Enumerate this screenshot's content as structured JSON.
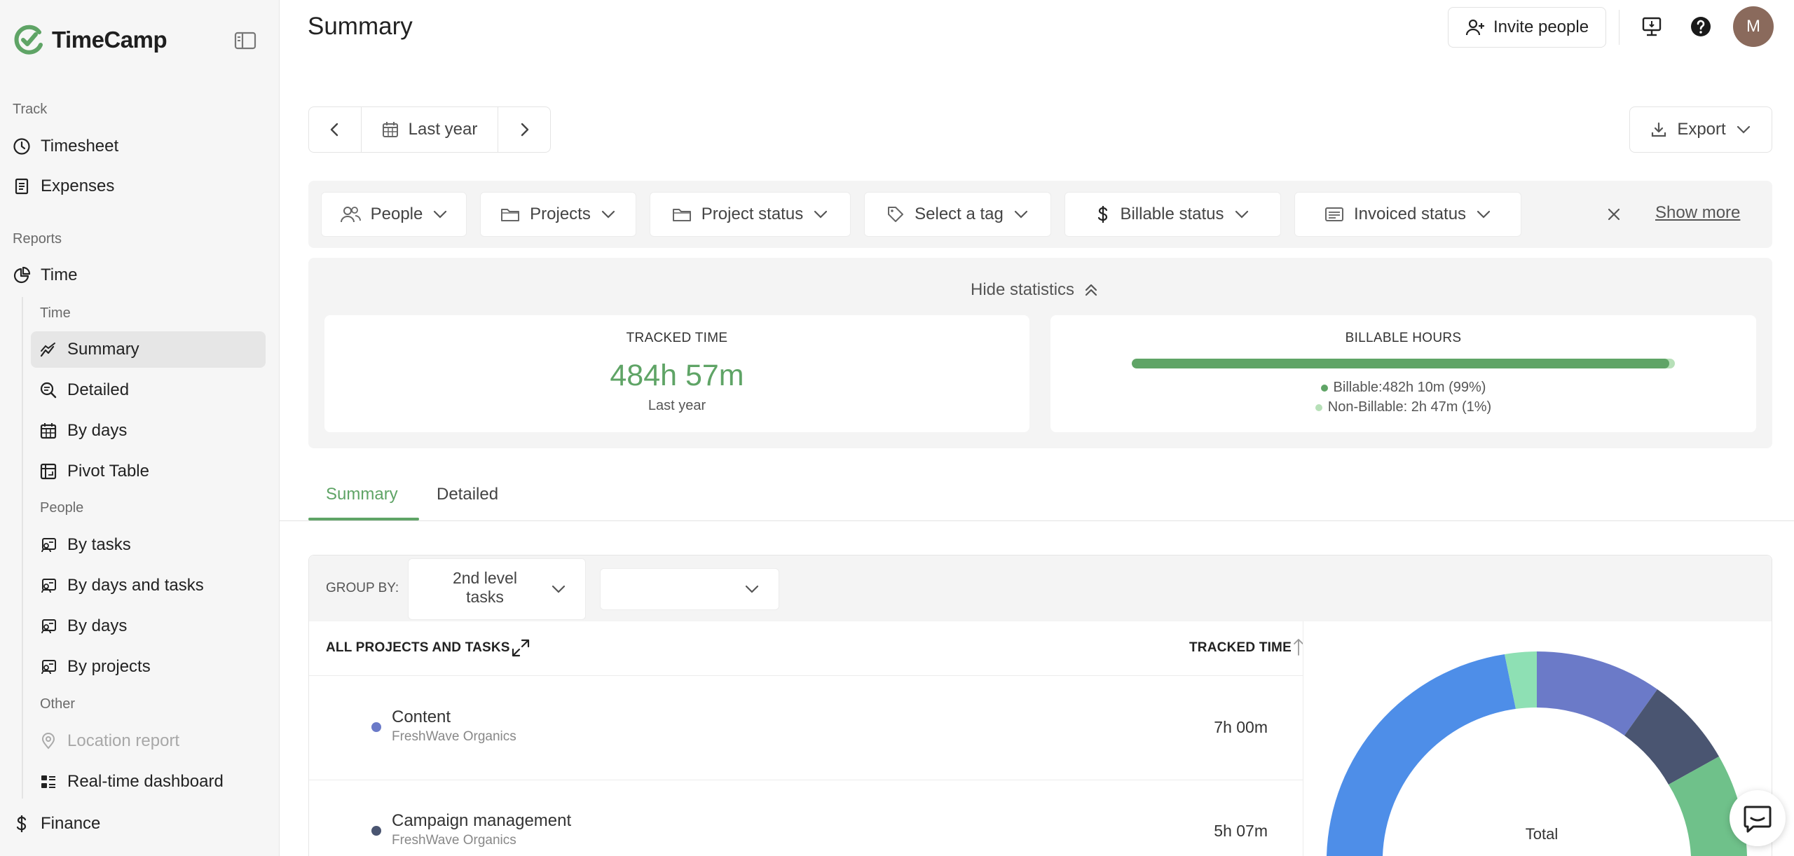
{
  "brand": {
    "name": "TimeCamp",
    "color": "#5fa466"
  },
  "sidebar": {
    "track_label": "Track",
    "track_items": [
      {
        "label": "Timesheet",
        "icon": "clock-icon"
      },
      {
        "label": "Expenses",
        "icon": "receipt-icon"
      }
    ],
    "reports_label": "Reports",
    "time_item": {
      "label": "Time",
      "icon": "pie-chart-icon"
    },
    "time_group_label": "Time",
    "time_items": [
      {
        "label": "Summary",
        "icon": "line-chart-icon",
        "active": true
      },
      {
        "label": "Detailed",
        "icon": "magnify-icon"
      },
      {
        "label": "By days",
        "icon": "calendar-grid-icon"
      },
      {
        "label": "Pivot Table",
        "icon": "pivot-table-icon"
      }
    ],
    "people_group_label": "People",
    "people_items": [
      {
        "label": "By tasks",
        "icon": "person-card-icon"
      },
      {
        "label": "By days and tasks",
        "icon": "person-card-icon"
      },
      {
        "label": "By days",
        "icon": "person-card-icon"
      },
      {
        "label": "By projects",
        "icon": "person-card-icon"
      }
    ],
    "other_group_label": "Other",
    "other_items": [
      {
        "label": "Location report",
        "icon": "location-pin-icon",
        "disabled": true
      },
      {
        "label": "Real-time dashboard",
        "icon": "dashboard-icon"
      }
    ],
    "finance_item": {
      "label": "Finance",
      "icon": "dollar-icon"
    }
  },
  "header": {
    "title": "Summary",
    "invite_label": "Invite people",
    "avatar_initial": "M"
  },
  "date_range": {
    "label": "Last year"
  },
  "export_label": "Export",
  "filters": {
    "people": "People",
    "projects": "Projects",
    "project_status": "Project status",
    "tag": "Select a tag",
    "billable": "Billable status",
    "invoiced": "Invoiced status",
    "show_more": "Show more"
  },
  "stats": {
    "toggle_label": "Hide statistics",
    "tracked": {
      "title": "TRACKED TIME",
      "value": "484h 57m",
      "sub": "Last year"
    },
    "billable": {
      "title": "BILLABLE HOURS",
      "billable_fraction": 0.99,
      "billable_text": "Billable:482h 10m (99%)",
      "non_billable_text": "Non-Billable: 2h 47m (1%)"
    }
  },
  "tabs": {
    "summary": "Summary",
    "detailed": "Detailed"
  },
  "table": {
    "group_by_label": "GROUP BY:",
    "group_by_value": "2nd level tasks",
    "group_by_second": "",
    "col_left": "ALL PROJECTS AND TASKS",
    "col_right": "TRACKED TIME",
    "rows": [
      {
        "name": "Content",
        "client": "FreshWave Organics",
        "time": "7h 00m",
        "color": "#6b7ac8"
      },
      {
        "name": "Campaign management",
        "client": "FreshWave Organics",
        "time": "5h 07m",
        "color": "#4a5571"
      }
    ]
  },
  "donut": {
    "center_label": "Total",
    "segments": [
      {
        "color": "#6b7ac8"
      },
      {
        "color": "#4a5571"
      },
      {
        "color": "#6fc18a"
      },
      {
        "color": "#4e8ee8"
      },
      {
        "color": "#8ee0b4"
      }
    ]
  }
}
